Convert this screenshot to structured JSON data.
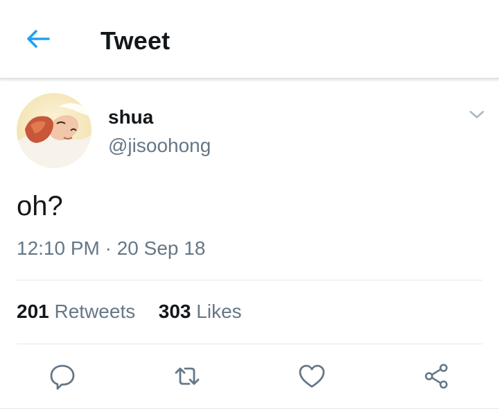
{
  "header": {
    "title": "Tweet",
    "back_icon": "arrow-left-icon",
    "accent": "#1da1f2"
  },
  "tweet": {
    "author": {
      "display_name": "shua",
      "handle": "@jisoohong",
      "avatar_icon": "avatar-photo"
    },
    "text": "oh?",
    "timestamp": "12:10 PM · 20 Sep 18",
    "caret_icon": "chevron-down-icon"
  },
  "stats": {
    "retweets_count": "201",
    "retweets_label": "Retweets",
    "likes_count": "303",
    "likes_label": "Likes"
  },
  "actions": {
    "reply_icon": "reply-icon",
    "retweet_icon": "retweet-icon",
    "like_icon": "heart-icon",
    "share_icon": "share-icon",
    "icon_color": "#657786"
  }
}
